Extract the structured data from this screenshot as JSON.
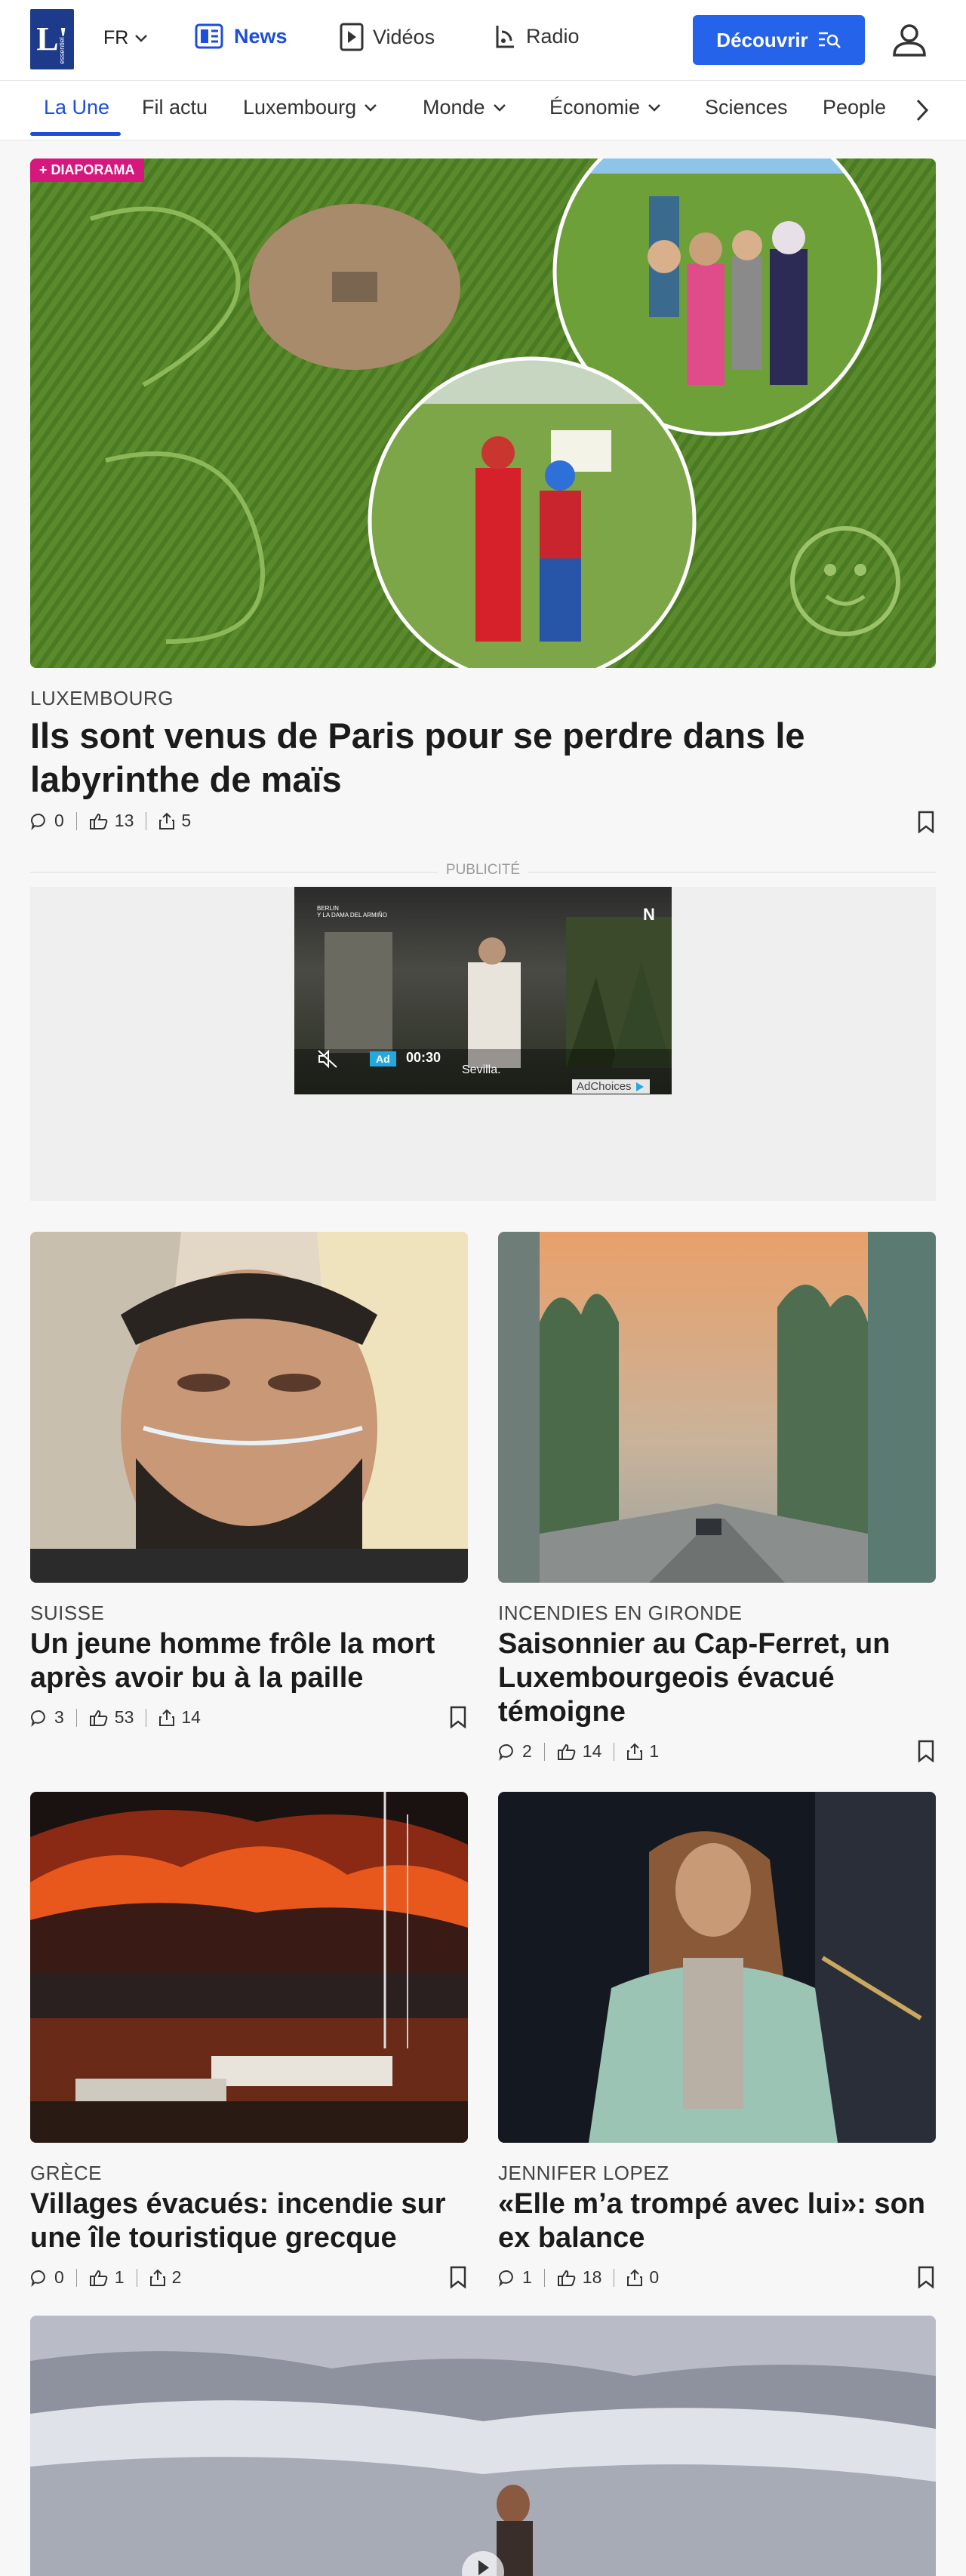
{
  "header": {
    "logo_text": "L'",
    "logo_sub": "essentiel",
    "lang": "FR",
    "nav": [
      {
        "label": "News"
      },
      {
        "label": "Vidéos"
      },
      {
        "label": "Radio"
      }
    ],
    "cta": "Découvrir"
  },
  "subnav": {
    "items": [
      "La Une",
      "Fil actu",
      "Luxembourg",
      "Monde",
      "Économie",
      "Sciences",
      "People"
    ]
  },
  "hero": {
    "badge": "+ DIAPORAMA",
    "kicker": "LUXEMBOURG",
    "title": "Ils sont venus de Paris pour se perdre dans le labyrinthe de maïs",
    "comments": "0",
    "likes": "13",
    "shares": "5"
  },
  "ad": {
    "label": "PUBLICITÉ",
    "video_text_1": "BERLIN",
    "video_text_2": "Y LA DAMA DEL ARMIÑO",
    "badge": "Ad",
    "time": "00:30",
    "caption": "Sevilla.",
    "adchoices": "AdChoices",
    "n": "N"
  },
  "articles": [
    {
      "kicker": "SUISSE",
      "title": "Un jeune homme frôle la mort après avoir bu à la paille",
      "comments": "3",
      "likes": "53",
      "shares": "14"
    },
    {
      "kicker": "INCENDIES EN GIRONDE",
      "title": "Saisonnier au Cap-Ferret, un Luxembourgeois évacué témoigne",
      "comments": "2",
      "likes": "14",
      "shares": "1"
    },
    {
      "kicker": "GRÈCE",
      "title": "Villages évacués: incendie sur une île touristique grecque",
      "comments": "0",
      "likes": "1",
      "shares": "2"
    },
    {
      "kicker": "JENNIFER LOPEZ",
      "title": "«Elle m’a trompé avec lui»: son ex balance",
      "comments": "1",
      "likes": "18",
      "shares": "0"
    }
  ],
  "colors": {
    "accent": "#1d4ed8",
    "cta": "#2563eb",
    "badge": "#d6177d"
  }
}
